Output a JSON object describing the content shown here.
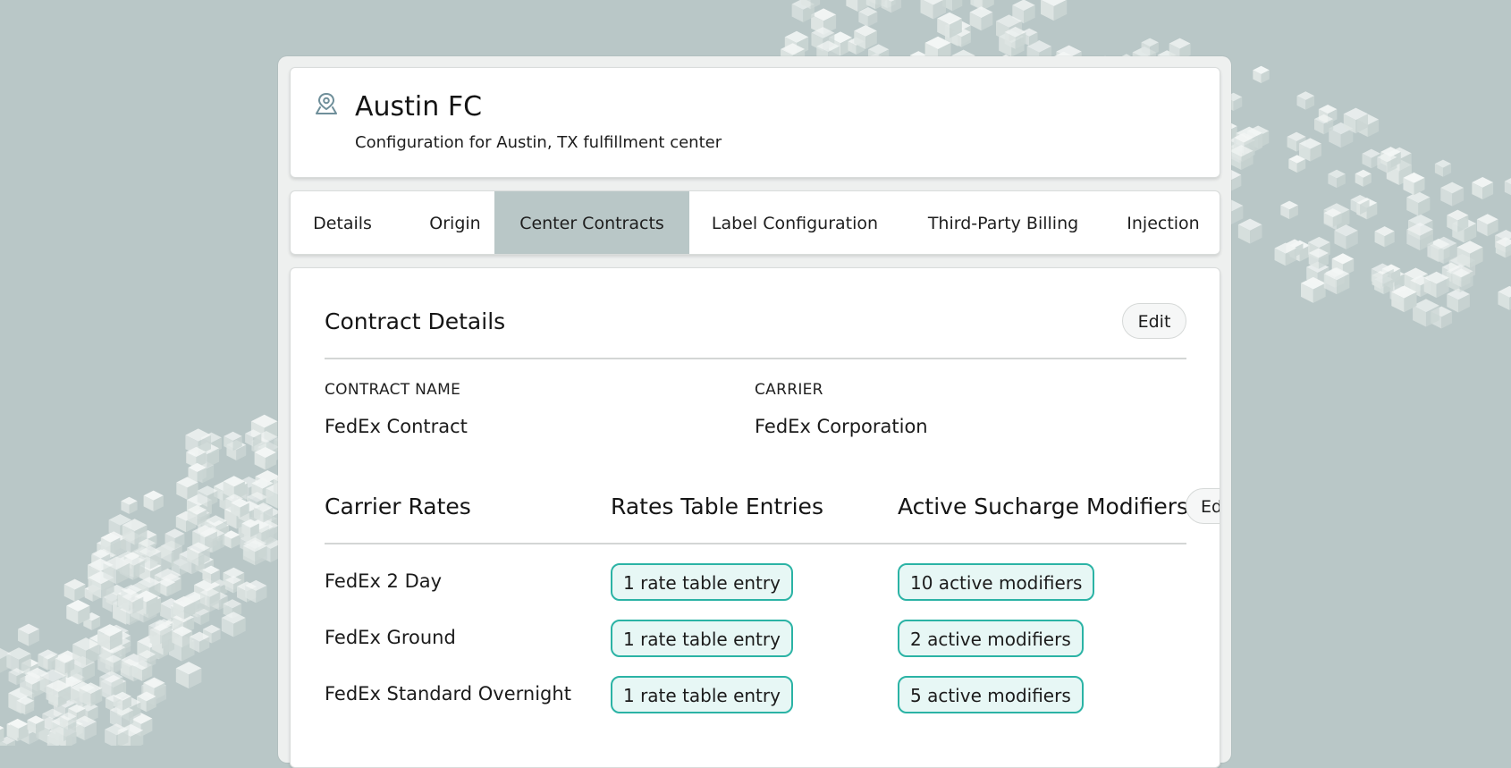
{
  "header": {
    "icon": "map-pin-icon",
    "title": "Austin FC",
    "subtitle": "Configuration for Austin, TX fulfillment center"
  },
  "tabs": [
    {
      "label": "Details",
      "active": false
    },
    {
      "label": "Origin",
      "active": false
    },
    {
      "label": "Center Contracts",
      "active": true
    },
    {
      "label": "Label Configuration",
      "active": false
    },
    {
      "label": "Third-Party Billing",
      "active": false
    },
    {
      "label": "Injection",
      "active": false
    }
  ],
  "contract_details": {
    "title": "Contract Details",
    "edit_label": "Edit",
    "fields": [
      {
        "label": "CONTRACT NAME",
        "value": "FedEx Contract"
      },
      {
        "label": "CARRIER",
        "value": "FedEx Corporation"
      }
    ]
  },
  "carrier_rates": {
    "columns": [
      "Carrier Rates",
      "Rates Table Entries",
      "Active Sucharge Modifiers"
    ],
    "edit_label": "Edit",
    "rows": [
      {
        "name": "FedEx 2 Day",
        "entries": "1 rate table entry",
        "modifiers": "10 active modifiers"
      },
      {
        "name": "FedEx Ground",
        "entries": "1 rate table entry",
        "modifiers": "2 active modifiers"
      },
      {
        "name": "FedEx Standard Overnight",
        "entries": "1 rate table entry",
        "modifiers": "5 active modifiers"
      }
    ]
  },
  "colors": {
    "background": "#b9c7c7",
    "active_tab": "#b9c7c7",
    "pill_border": "#2bb3a5",
    "pill_fill": "#e7f7f5"
  }
}
